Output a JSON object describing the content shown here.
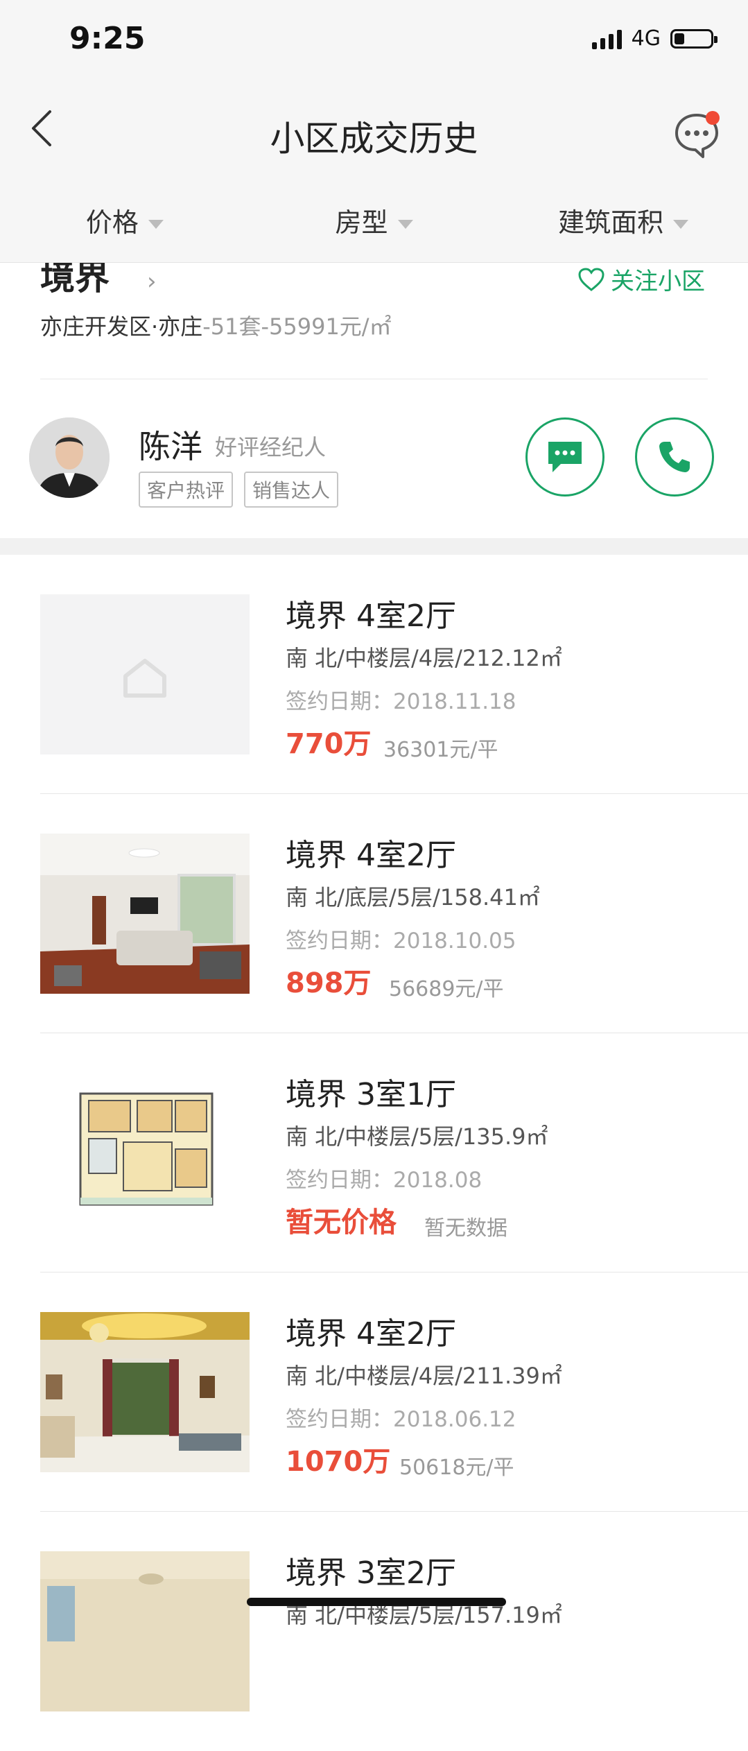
{
  "status": {
    "time": "9:25",
    "network": "4G"
  },
  "nav": {
    "title": "小区成交历史"
  },
  "filters": [
    {
      "label": "价格"
    },
    {
      "label": "房型"
    },
    {
      "label": "建筑面积"
    }
  ],
  "community": {
    "name": "境界",
    "follow_label": "关注小区",
    "district": "亦庄开发区·亦庄",
    "stats": "-51套-55991元/㎡"
  },
  "agent": {
    "name": "陈洋",
    "title": "好评经纪人",
    "tags": [
      "客户热评",
      "销售达人"
    ]
  },
  "listings": [
    {
      "title": "境界 4室2厅",
      "spec": "南 北/中楼层/4层/212.12㎡",
      "date": "签约日期：2018.11.18",
      "price": "770万",
      "unit_price": "36301元/平",
      "image": "placeholder"
    },
    {
      "title": "境界 4室2厅",
      "spec": "南 北/底层/5层/158.41㎡",
      "date": "签约日期：2018.10.05",
      "price": "898万",
      "unit_price": "56689元/平",
      "image": "living-room"
    },
    {
      "title": "境界 3室1厅",
      "spec": "南 北/中楼层/5层/135.9㎡",
      "date": "签约日期：2018.08",
      "price": "暂无价格",
      "unit_price": "暂无数据",
      "image": "floor-plan"
    },
    {
      "title": "境界 4室2厅",
      "spec": "南 北/中楼层/4层/211.39㎡",
      "date": "签约日期：2018.06.12",
      "price": "1070万",
      "unit_price": "50618元/平",
      "image": "living-room-chandelier"
    },
    {
      "title": "境界 3室2厅",
      "spec": "南 北/中楼层/5层/157.19㎡",
      "date": "",
      "price": "",
      "unit_price": "",
      "image": "room"
    }
  ],
  "colors": {
    "accent_green": "#1aa466",
    "price_red": "#e94e3a",
    "notification_dot": "#f04a35"
  }
}
